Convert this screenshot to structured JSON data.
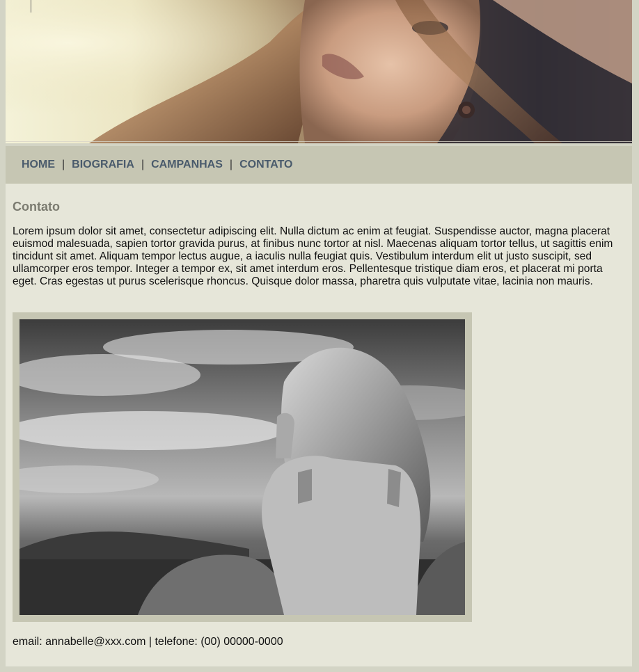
{
  "nav": {
    "items": [
      {
        "label": "HOME"
      },
      {
        "label": "BIOGRAFIA"
      },
      {
        "label": "CAMPANHAS"
      },
      {
        "label": "CONTATO"
      }
    ],
    "separator": "|"
  },
  "main": {
    "title": "Contato",
    "body": "Lorem ipsum dolor sit amet, consectetur adipiscing elit. Nulla dictum ac enim at feugiat. Suspendisse auctor, magna placerat euismod malesuada, sapien tortor gravida purus, at finibus nunc tortor at nisl. Maecenas aliquam tortor tellus, ut sagittis enim tincidunt sit amet. Aliquam tempor lectus augue, a iaculis nulla feugiat quis. Vestibulum interdum elit ut justo suscipit, sed ullamcorper eros tempor. Integer a tempor ex, sit amet interdum eros. Pellentesque tristique diam eros, et placerat mi porta eget. Cras egestas ut purus scelerisque rhoncus. Quisque dolor massa, pharetra quis vulputate vitae, lacinia non mauris.",
    "contact": "email: annabelle@xxx.com | telefone: (00) 00000-0000"
  },
  "colors": {
    "background": "#d3d4c5",
    "nav_bg": "#c6c6b3",
    "content_bg": "#e6e6d9",
    "nav_text": "#4a5b6c",
    "heading": "#7b7b70"
  }
}
